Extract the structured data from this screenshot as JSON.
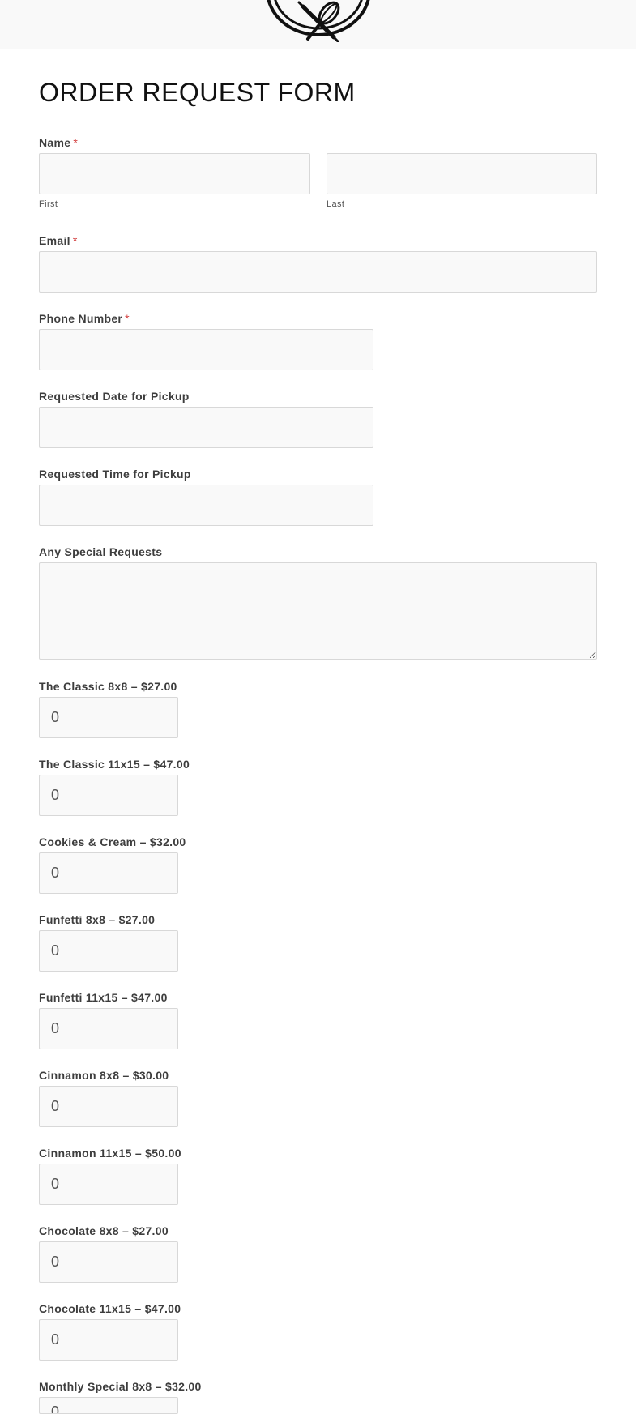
{
  "header": {
    "logo_icon": "whisk-rolling-pin-logo"
  },
  "form": {
    "title": "ORDER REQUEST FORM",
    "required_marker": "*",
    "name": {
      "label": "Name",
      "first_sublabel": "First",
      "last_sublabel": "Last",
      "first_value": "",
      "last_value": ""
    },
    "email": {
      "label": "Email",
      "value": ""
    },
    "phone": {
      "label": "Phone Number",
      "value": ""
    },
    "pickup_date": {
      "label": "Requested Date for Pickup",
      "value": ""
    },
    "pickup_time": {
      "label": "Requested Time for Pickup",
      "value": ""
    },
    "special_requests": {
      "label": "Any Special Requests",
      "value": ""
    },
    "products": [
      {
        "label": "The Classic 8x8 – $27.00",
        "quantity": "0"
      },
      {
        "label": "The Classic 11x15 – $47.00",
        "quantity": "0"
      },
      {
        "label": "Cookies & Cream – $32.00",
        "quantity": "0"
      },
      {
        "label": "Funfetti 8x8 – $27.00",
        "quantity": "0"
      },
      {
        "label": "Funfetti 11x15 – $47.00",
        "quantity": "0"
      },
      {
        "label": "Cinnamon 8x8 – $30.00",
        "quantity": "0"
      },
      {
        "label": "Cinnamon 11x15 – $50.00",
        "quantity": "0"
      },
      {
        "label": "Chocolate 8x8 – $27.00",
        "quantity": "0"
      },
      {
        "label": "Chocolate 11x15 – $47.00",
        "quantity": "0"
      },
      {
        "label": "Monthly Special 8x8 – $32.00",
        "quantity": "0"
      }
    ]
  },
  "colors": {
    "required": "#d23b3b",
    "field_background": "#f9f9f9",
    "field_border": "#d8d8d8",
    "header_band": "#f9f9f9"
  }
}
